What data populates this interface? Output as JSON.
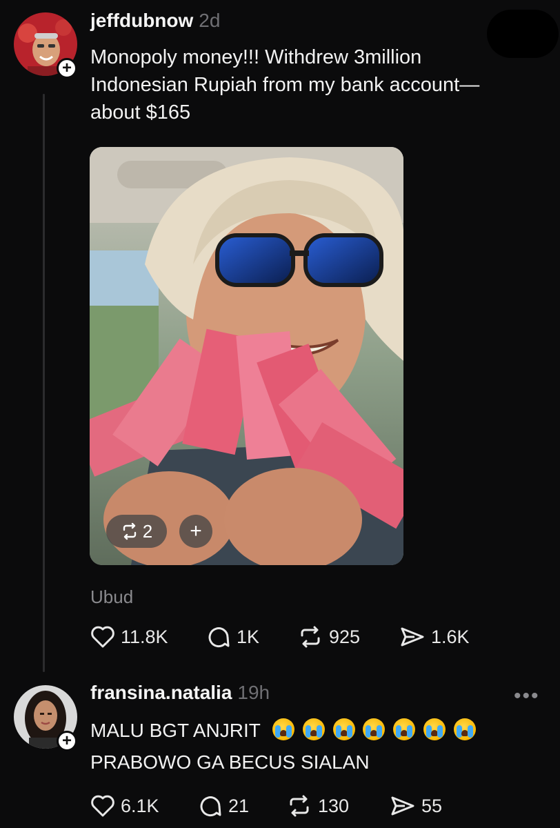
{
  "post": {
    "username": "jeffdubnow",
    "time": "2d",
    "text_lines": [
      "Monopoly money!!! Withdrew 3million",
      "Indonesian Rupiah from my bank account—",
      "about $165"
    ],
    "media": {
      "repost_count": "2",
      "add_label": "+"
    },
    "location": "Ubud",
    "stats": {
      "likes": "11.8K",
      "replies": "1K",
      "reposts": "925",
      "shares": "1.6K"
    }
  },
  "reply": {
    "username": "fransina.natalia",
    "time": "19h",
    "text_line1": "MALU BGT ANJRIT",
    "text_line2": "PRABOWO GA BECUS SIALAN",
    "emoji_count": 7,
    "emoji_name": "loudly-crying-face",
    "stats": {
      "likes": "6.1K",
      "replies": "21",
      "reposts": "130",
      "shares": "55"
    }
  },
  "follow_label": "+",
  "more_label": "•••",
  "colors": {
    "background": "#0b0b0c",
    "muted": "#8a8a8e",
    "banknote": "#e05a72"
  }
}
